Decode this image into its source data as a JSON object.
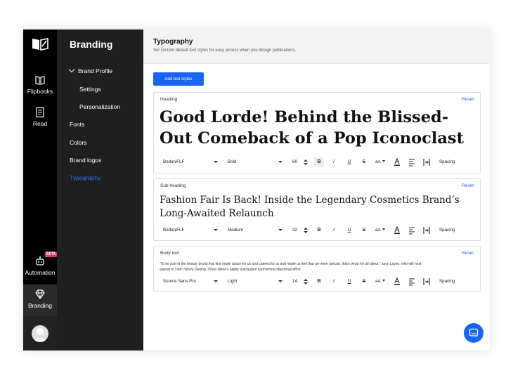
{
  "rail": {
    "items": [
      {
        "label": "Flipbooks",
        "icon": "book-icon"
      },
      {
        "label": "Read",
        "icon": "document-icon"
      },
      {
        "label": "Automation",
        "icon": "robot-icon",
        "badge": "BETA"
      },
      {
        "label": "Branding",
        "icon": "diamond-icon"
      }
    ]
  },
  "sidebar": {
    "title": "Branding",
    "items": [
      {
        "label": "Brand Profile"
      },
      {
        "label": "Settings"
      },
      {
        "label": "Personalization"
      },
      {
        "label": "Fonts"
      },
      {
        "label": "Colors"
      },
      {
        "label": "Brand logos"
      },
      {
        "label": "Typography"
      }
    ]
  },
  "header": {
    "title": "Typography",
    "subtitle": "Set custom default text styles for easy access when you design publications."
  },
  "add_button_label": "Add text styles",
  "reset_label": "Reset",
  "spacing_label": "Spacing",
  "case_label": "aA",
  "styles": [
    {
      "label": "Heading",
      "sample": "Good Lorde! Behind the Blissed-Out Comeback of a Pop Iconoclast",
      "font": "BodoniFLF",
      "weight": "Bold",
      "size": "60"
    },
    {
      "label": "Sub heading",
      "sample": "Fashion Fair Is Back! Inside the Legendary Cosmetics Brand’s Long-Awaited Relaunch",
      "font": "BodoniFLF",
      "weight": "Medium",
      "size": "32"
    },
    {
      "label": "Body text",
      "sample": "“To be part of the beauty brand that first made space for us and catered to us and made us feel that we were special, that’s what I’m all about,” says Layne, who will next appear in Don’t Worry Darling, Olivia Wilde’s highly anticipated sophomore directorial effort.",
      "font": "Source Sans Pro",
      "weight": "Light",
      "size": "14"
    }
  ],
  "colors": {
    "accent": "#1a64f5",
    "rail": "#000000",
    "sidebar": "#1f1f1f",
    "beta": "#e8375a"
  }
}
